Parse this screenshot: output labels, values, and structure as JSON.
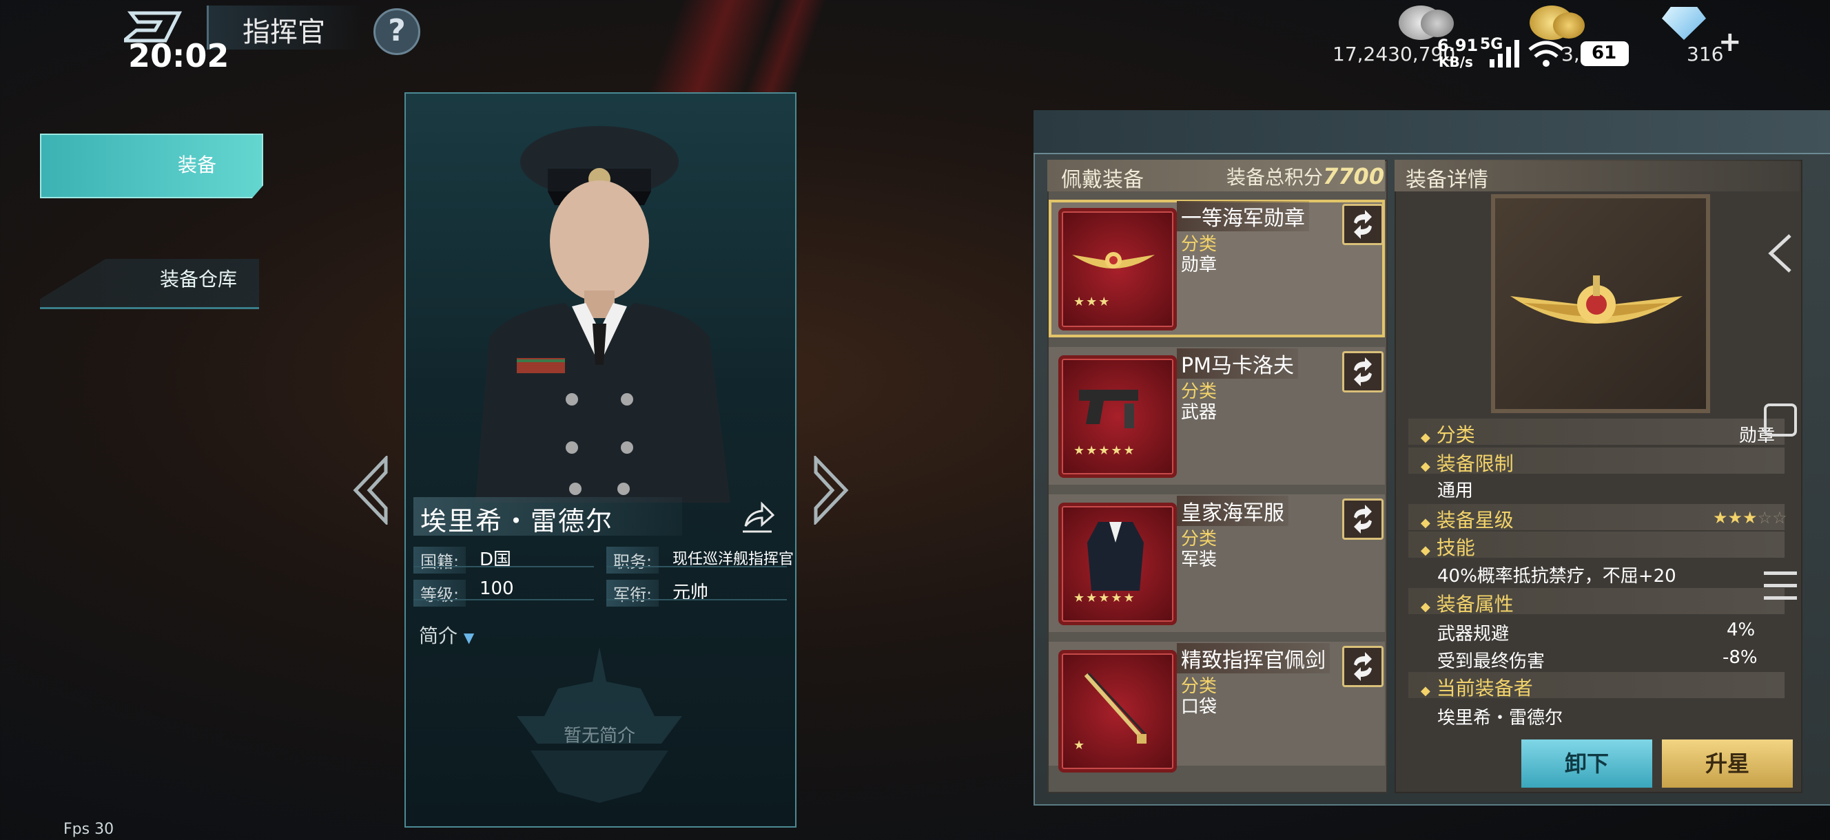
{
  "header": {
    "title": "指挥官",
    "help": "?",
    "clock": "20:02",
    "silver": "17,2430,790",
    "gold": "3,2",
    "gems": "316",
    "gems_plus": "+",
    "network_speed": "6.91",
    "network_unit": "KB/s",
    "network_type": "5G",
    "battery": "61"
  },
  "nav": {
    "equipment": "装备",
    "warehouse": "装备仓库"
  },
  "commander": {
    "name": "埃里希・雷德尔",
    "nationality_label": "国籍:",
    "nationality": "D国",
    "position_label": "职务:",
    "position": "现任巡洋舰指挥官",
    "level_label": "等级:",
    "level": "100",
    "rank_label": "军衔:",
    "rank": "元帅",
    "intro_label": "简介",
    "no_intro": "暂无简介"
  },
  "equipment_list": {
    "title": "佩戴装备",
    "score_label": "装备总积分",
    "score": "7700",
    "category_label": "分类",
    "items": [
      {
        "name": "一等海军勋章",
        "category": "勋章",
        "stars": 3
      },
      {
        "name": "PM马卡洛夫",
        "category": "武器",
        "stars": 5
      },
      {
        "name": "皇家海军服",
        "category": "军装",
        "stars": 5
      },
      {
        "name": "精致指挥官佩剑",
        "category": "口袋",
        "stars": 1
      }
    ]
  },
  "details": {
    "title": "装备详情",
    "category_label": "分类",
    "category": "勋章",
    "limit_label": "装备限制",
    "limit": "通用",
    "star_label": "装备星级",
    "star_value": 3,
    "star_max": 5,
    "skill_label": "技能",
    "skill": "40%概率抵抗禁疗，不屈+20",
    "attr_label": "装备属性",
    "attrs": [
      {
        "name": "武器规避",
        "value": "4%"
      },
      {
        "name": "受到最终伤害",
        "value": "-8%"
      }
    ],
    "wearer_label": "当前装备者",
    "wearer": "埃里希・雷德尔",
    "unequip": "卸下",
    "upgrade": "升星"
  },
  "fps": "Fps 30",
  "colors": {
    "accent_teal": "#3cb2b4",
    "gold": "#f3d36a",
    "item_red": "#a8202a"
  }
}
